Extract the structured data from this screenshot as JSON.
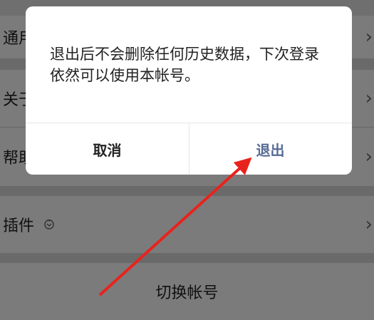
{
  "settings_rows": [
    {
      "label": "通用"
    },
    {
      "label": "关于"
    },
    {
      "label": "帮助"
    },
    {
      "label": "插件"
    }
  ],
  "switch_account": {
    "label": "切换帐号"
  },
  "dialog": {
    "message": "退出后不会删除任何历史数据，下次登录依然可以使用本帐号。",
    "cancel_label": "取消",
    "confirm_label": "退出"
  },
  "colors": {
    "dialog_confirm": "#576b95",
    "annotation_arrow": "#e8231d",
    "overlay_bg": "#6f6f6f"
  },
  "icons": {
    "chevron": "chevron-right-icon",
    "plugin": "plugin-icon"
  }
}
